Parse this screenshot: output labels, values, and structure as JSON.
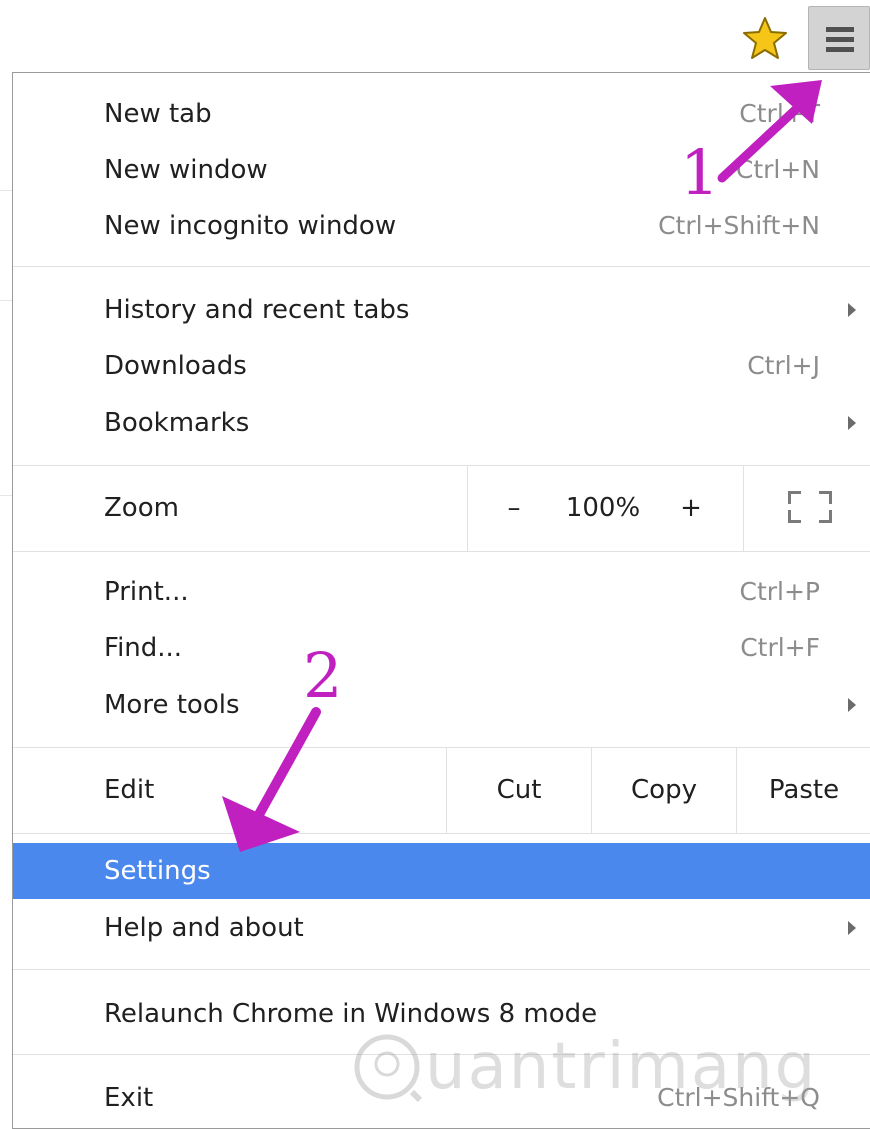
{
  "toolbar": {
    "bookmark_star_icon": "star-icon",
    "menu_icon": "hamburger-menu-icon"
  },
  "menu": {
    "group1": [
      {
        "label": "New tab",
        "shortcut": "Ctrl+T"
      },
      {
        "label": "New window",
        "shortcut": "Ctrl+N"
      },
      {
        "label": "New incognito window",
        "shortcut": "Ctrl+Shift+N"
      }
    ],
    "group2": [
      {
        "label": "History and recent tabs",
        "submenu": true
      },
      {
        "label": "Downloads",
        "shortcut": "Ctrl+J"
      },
      {
        "label": "Bookmarks",
        "submenu": true
      }
    ],
    "zoom": {
      "label": "Zoom",
      "minus": "–",
      "value": "100%",
      "plus": "+",
      "fullscreen_icon": "fullscreen-icon"
    },
    "group3": [
      {
        "label": "Print...",
        "shortcut": "Ctrl+P"
      },
      {
        "label": "Find...",
        "shortcut": "Ctrl+F"
      },
      {
        "label": "More tools",
        "submenu": true
      }
    ],
    "edit": {
      "label": "Edit",
      "cut": "Cut",
      "copy": "Copy",
      "paste": "Paste"
    },
    "group4": [
      {
        "label": "Settings",
        "highlighted": true
      },
      {
        "label": "Help and about",
        "submenu": true
      }
    ],
    "relaunch": {
      "label": "Relaunch Chrome in Windows 8 mode"
    },
    "exit": {
      "label": "Exit",
      "shortcut": "Ctrl+Shift+Q"
    }
  },
  "annotations": {
    "step1": "1",
    "step2": "2",
    "color": "#c020c0"
  },
  "watermark": {
    "text": "uantrimang"
  },
  "colors": {
    "highlight": "#4b88ee",
    "menu_button": "#d3d3d3"
  }
}
